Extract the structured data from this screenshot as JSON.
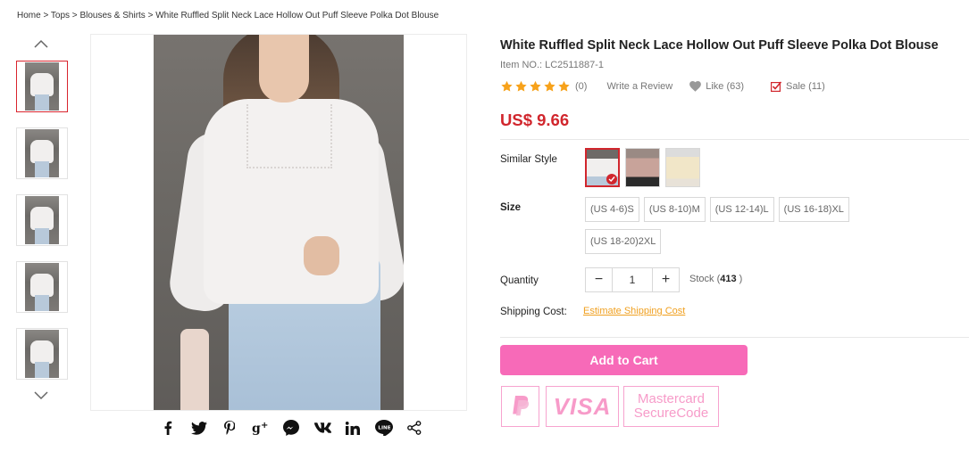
{
  "breadcrumb": {
    "items": [
      "Home",
      "Tops",
      "Blouses & Shirts",
      "White Ruffled Split Neck Lace Hollow Out Puff Sleeve Polka Dot Blouse"
    ],
    "separator": " > "
  },
  "gallery": {
    "thumbnail_count": 5,
    "active_index": 0
  },
  "share": {
    "icons": [
      "facebook-icon",
      "twitter-icon",
      "pinterest-icon",
      "google-plus-icon",
      "messenger-icon",
      "vk-icon",
      "linkedin-icon",
      "line-icon",
      "share-icon"
    ]
  },
  "product": {
    "title": "White Ruffled Split Neck Lace Hollow Out Puff Sleeve Polka Dot Blouse",
    "item_no": "Item NO.: LC2511887-1",
    "rating_stars": 5,
    "review_count": "(0)",
    "write_review": "Write a Review",
    "like": "Like (63)",
    "sale": "Sale (11)",
    "price": "US$ 9.66"
  },
  "similar_style": {
    "label": "Similar Style",
    "selected_index": 0
  },
  "size": {
    "label": "Size",
    "options": [
      "(US 4-6)S",
      "(US 8-10)M",
      "(US 12-14)L",
      "(US 16-18)XL",
      "(US 18-20)2XL"
    ]
  },
  "quantity": {
    "label": "Quantity",
    "minus": "−",
    "plus": "+",
    "value": "1",
    "stock_prefix": "Stock (",
    "stock_value": "413",
    "stock_suffix": ")"
  },
  "shipping": {
    "label": "Shipping Cost:",
    "link": "Estimate Shipping Cost"
  },
  "cart": {
    "add_label": "Add to Cart"
  },
  "payment": {
    "visa": "VISA",
    "mastercard_line1": "Mastercard",
    "mastercard_line2": "SecureCode"
  },
  "colors": {
    "price": "#d1262d",
    "cart_button": "#f76ab8",
    "star": "#f7a21b",
    "link": "#f0a020",
    "payment_border": "#f7a3cf"
  }
}
